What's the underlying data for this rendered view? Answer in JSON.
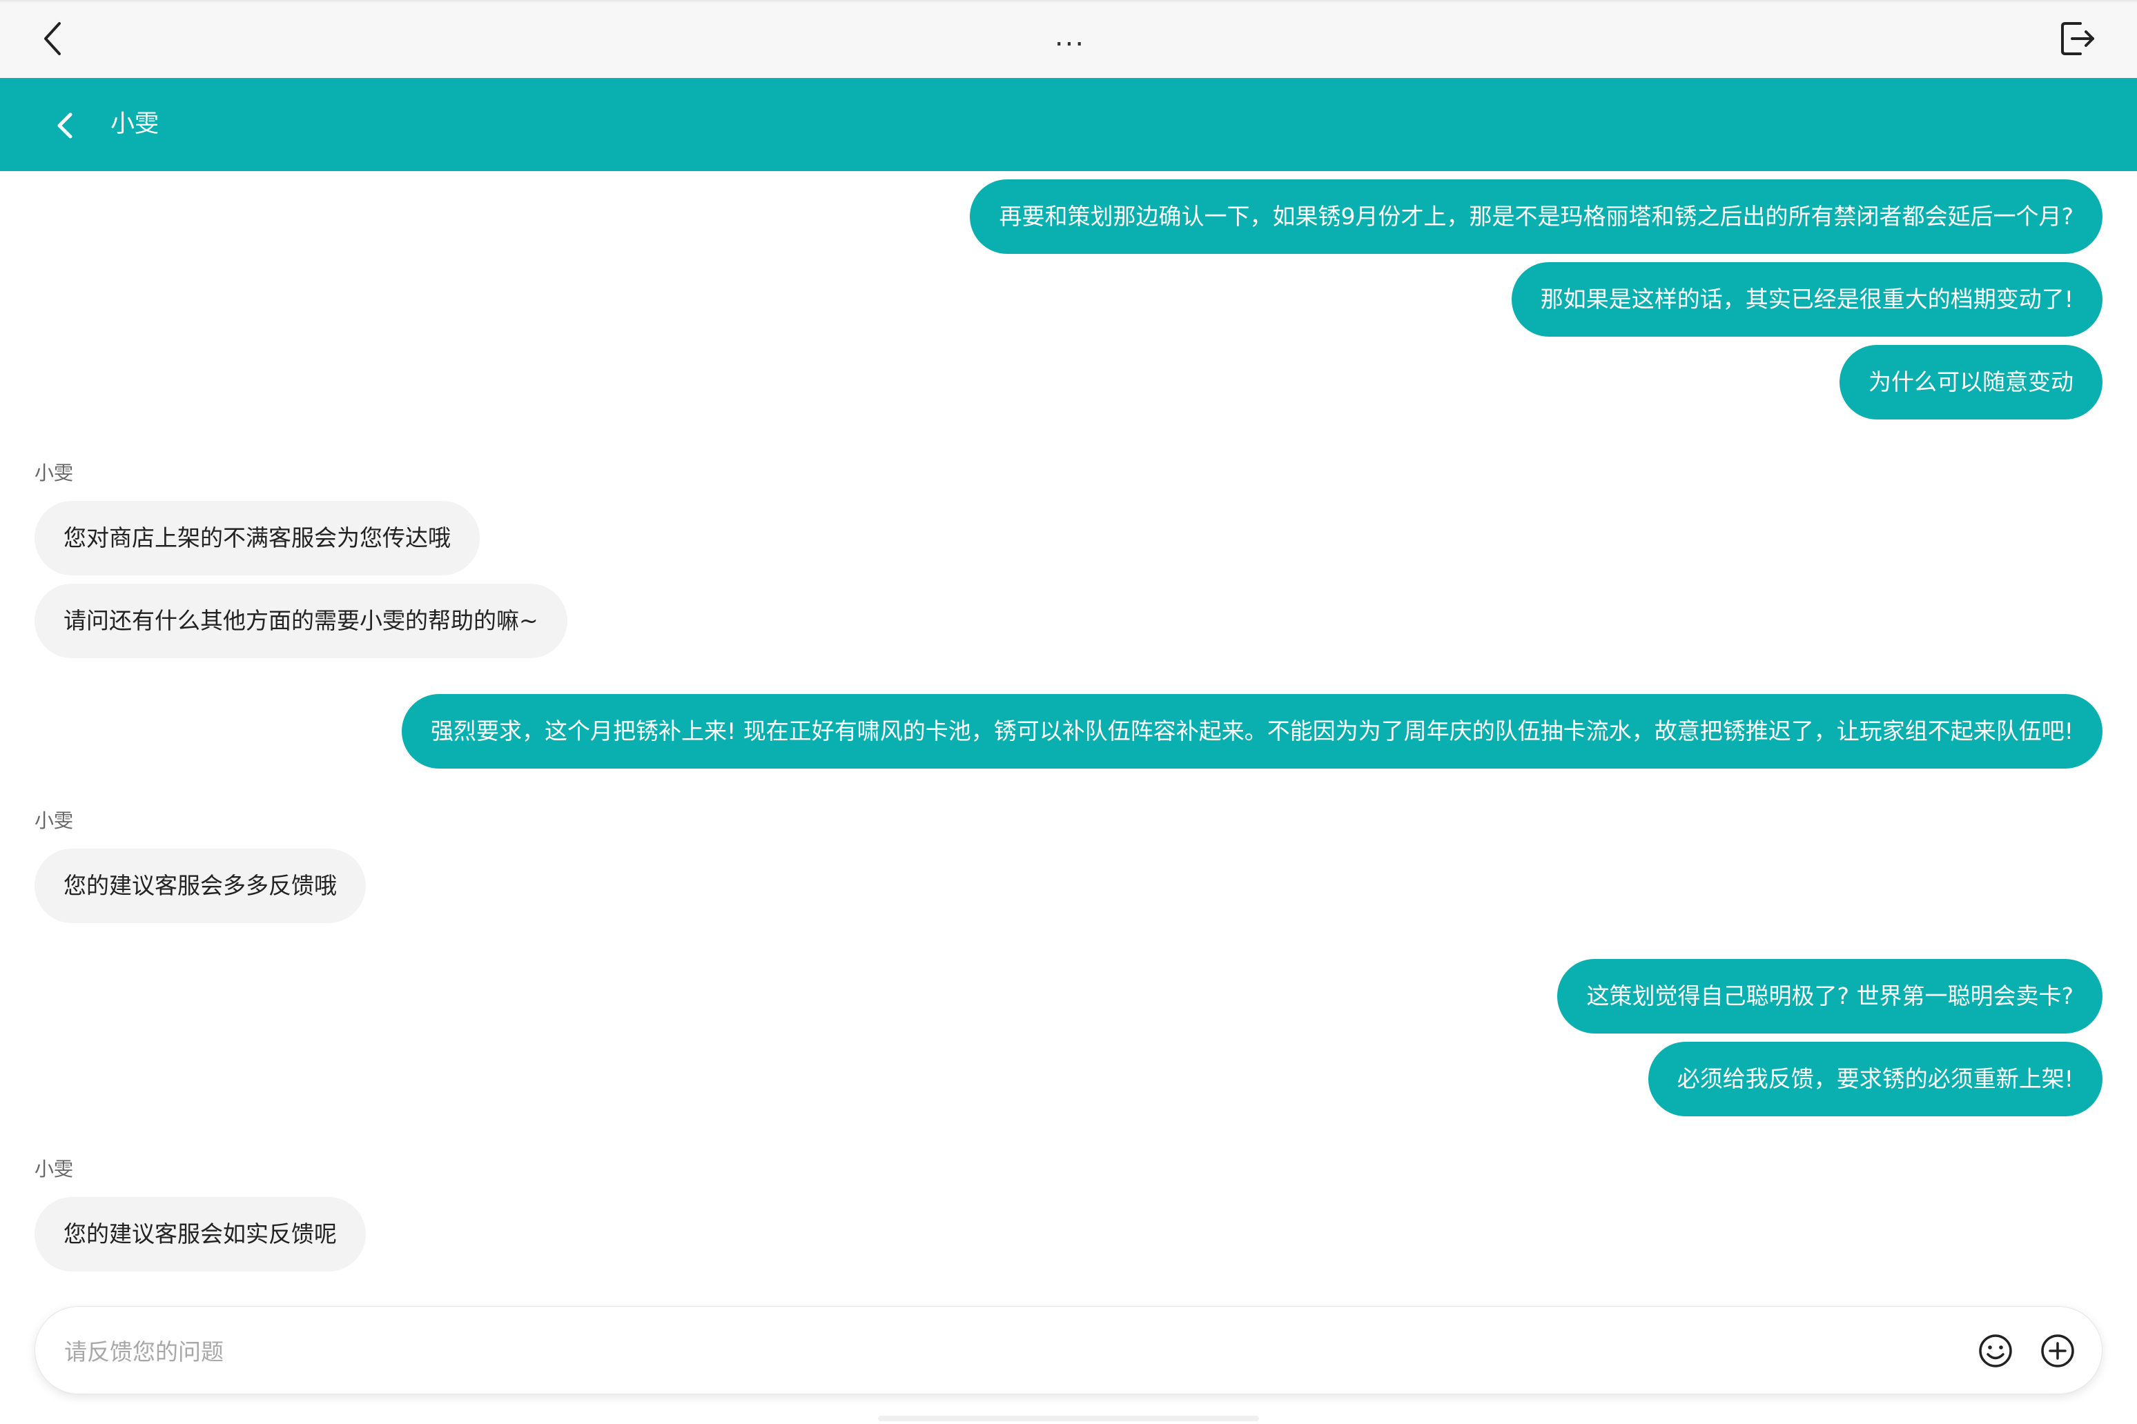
{
  "topbar": {
    "more_label": "..."
  },
  "header": {
    "title": "小雯"
  },
  "messages": [
    {
      "from": "user",
      "text": "再要和策划那边确认一下，如果锈9月份才上，那是不是玛格丽塔和锈之后出的所有禁闭者都会延后一个月?"
    },
    {
      "from": "user",
      "text": "那如果是这样的话，其实已经是很重大的档期变动了!"
    },
    {
      "from": "user",
      "text": "为什么可以随意变动"
    },
    {
      "from": "agent",
      "text": "您对商店上架的不满客服会为您传达哦"
    },
    {
      "from": "agent",
      "text": "请问还有什么其他方面的需要小雯的帮助的嘛~"
    },
    {
      "from": "user",
      "text": "强烈要求，这个月把锈补上来! 现在正好有啸风的卡池，锈可以补队伍阵容补起来。不能因为为了周年庆的队伍抽卡流水，故意把锈推迟了，让玩家组不起来队伍吧!"
    },
    {
      "from": "agent",
      "text": "您的建议客服会多多反馈哦"
    },
    {
      "from": "user",
      "text": "这策划觉得自己聪明极了? 世界第一聪明会卖卡?"
    },
    {
      "from": "user",
      "text": "必须给我反馈，要求锈的必须重新上架!"
    },
    {
      "from": "agent",
      "text": "您的建议客服会如实反馈呢"
    }
  ],
  "senders": [
    "小雯",
    "小雯",
    "小雯"
  ],
  "input": {
    "placeholder": "请反馈您的问题",
    "value": ""
  },
  "colors": {
    "accent": "#0aafaf",
    "agent_bubble": "#f3f3f3",
    "background": "#ffffff"
  },
  "icons": {
    "top_back": "chevron-left-icon",
    "exit": "exit-icon",
    "header_back": "chevron-left-icon",
    "emoji": "emoji-icon",
    "add": "plus-circle-icon"
  }
}
